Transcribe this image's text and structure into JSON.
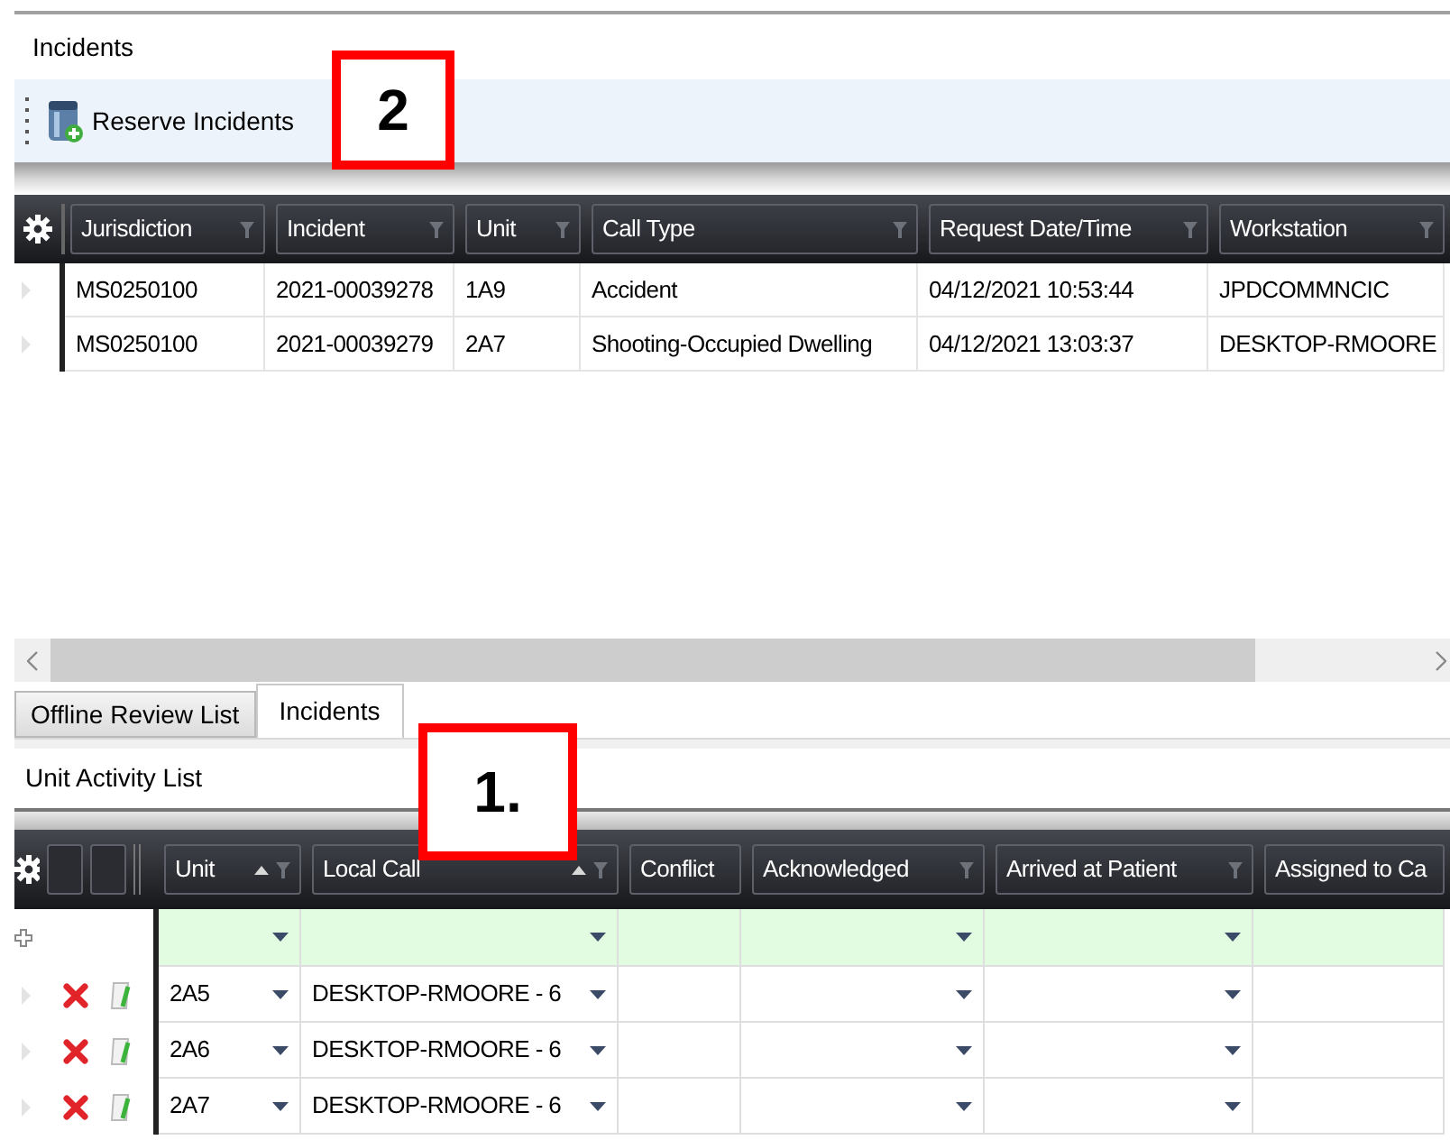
{
  "top_panel": {
    "title": "Incidents",
    "toolbar": [
      {
        "label": "Reserve Incidents"
      }
    ]
  },
  "incidents_grid": {
    "columns": [
      {
        "label": "Jurisdiction"
      },
      {
        "label": "Incident"
      },
      {
        "label": "Unit"
      },
      {
        "label": "Call Type"
      },
      {
        "label": "Request Date/Time"
      },
      {
        "label": "Workstation"
      }
    ],
    "rows": [
      {
        "cells": [
          "MS0250100",
          "2021-00039278",
          "1A9",
          "Accident",
          "04/12/2021 10:53:44",
          "JPDCOMMNCIC"
        ]
      },
      {
        "cells": [
          "MS0250100",
          "2021-00039279",
          "2A7",
          "Shooting-Occupied Dwelling",
          "04/12/2021 13:03:37",
          "DESKTOP-RMOORE"
        ]
      }
    ]
  },
  "tabs": [
    {
      "label": "Offline Review List",
      "selected": false
    },
    {
      "label": "Incidents",
      "selected": true
    }
  ],
  "unit_activity": {
    "title": "Unit Activity List",
    "columns": [
      {
        "label": "Unit",
        "sorted": true,
        "filter": true,
        "dropdown": true
      },
      {
        "label": "Local Call",
        "sorted": true,
        "filter": true,
        "dropdown": true
      },
      {
        "label": "Conflict",
        "sorted": false,
        "filter": false,
        "dropdown": false
      },
      {
        "label": "Acknowledged",
        "sorted": false,
        "filter": true,
        "dropdown": true
      },
      {
        "label": "Arrived at Patient",
        "sorted": false,
        "filter": true,
        "dropdown": true
      },
      {
        "label": "Assigned to Ca",
        "sorted": false,
        "filter": false,
        "dropdown": false
      }
    ],
    "rows": [
      {
        "unit": "2A5",
        "local_call": "DESKTOP-RMOORE - 6"
      },
      {
        "unit": "2A6",
        "local_call": "DESKTOP-RMOORE - 6"
      },
      {
        "unit": "2A7",
        "local_call": "DESKTOP-RMOORE - 6"
      }
    ]
  },
  "callouts": [
    {
      "label": "2"
    },
    {
      "label": "1."
    }
  ]
}
